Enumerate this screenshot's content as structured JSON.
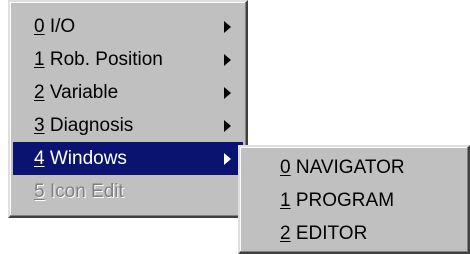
{
  "main_menu": {
    "items": [
      {
        "key": "0",
        "label": "I/O",
        "has_submenu": true,
        "selected": false,
        "disabled": false
      },
      {
        "key": "1",
        "label": "Rob. Position",
        "has_submenu": true,
        "selected": false,
        "disabled": false
      },
      {
        "key": "2",
        "label": "Variable",
        "has_submenu": true,
        "selected": false,
        "disabled": false
      },
      {
        "key": "3",
        "label": "Diagnosis",
        "has_submenu": true,
        "selected": false,
        "disabled": false
      },
      {
        "key": "4",
        "label": "Windows",
        "has_submenu": true,
        "selected": true,
        "disabled": false
      },
      {
        "key": "5",
        "label": "Icon Edit",
        "has_submenu": false,
        "selected": false,
        "disabled": true
      }
    ]
  },
  "sub_menu": {
    "items": [
      {
        "key": "0",
        "label": "NAVIGATOR"
      },
      {
        "key": "1",
        "label": "PROGRAM"
      },
      {
        "key": "2",
        "label": "EDITOR"
      }
    ]
  },
  "colors": {
    "menu_face": "#c0c0c0",
    "selection": "#0a1470",
    "disabled_text": "#808080"
  },
  "icons": {
    "submenu_arrow": "triangle-right-icon"
  }
}
